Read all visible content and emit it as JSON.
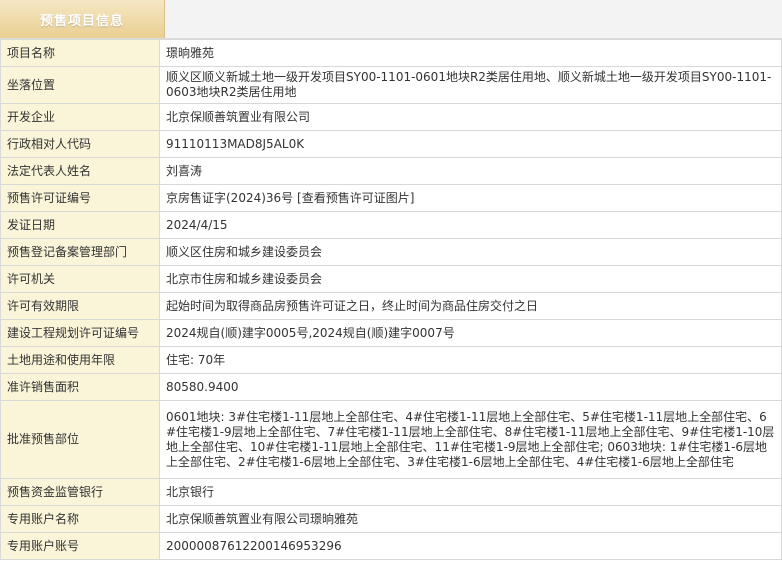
{
  "header": {
    "tab_title": "预售项目信息"
  },
  "fields": [
    {
      "label": "项目名称",
      "value": "璟晌雅苑"
    },
    {
      "label": "坐落位置",
      "value": "顺义区顺义新城土地一级开发项目SY00-1101-0601地块R2类居住用地、顺义新城土地一级开发项目SY00-1101-0603地块R2类居住用地"
    },
    {
      "label": "开发企业",
      "value": "北京保顺善筑置业有限公司"
    },
    {
      "label": "行政相对人代码",
      "value": "91110113MAD8J5AL0K"
    },
    {
      "label": "法定代表人姓名",
      "value": "刘喜涛"
    },
    {
      "label": "预售许可证编号",
      "value": "京房售证字(2024)36号",
      "link": "[查看预售许可证图片]"
    },
    {
      "label": "发证日期",
      "value": "2024/4/15"
    },
    {
      "label": "预售登记备案管理部门",
      "value": "顺义区住房和城乡建设委员会"
    },
    {
      "label": "许可机关",
      "value": "北京市住房和城乡建设委员会"
    },
    {
      "label": "许可有效期限",
      "value": "起始时间为取得商品房预售许可证之日，终止时间为商品住房交付之日"
    },
    {
      "label": "建设工程规划许可证编号",
      "value": "2024规自(顺)建字0005号,2024规自(顺)建字0007号"
    },
    {
      "label": "土地用途和使用年限",
      "value": "住宅: 70年"
    },
    {
      "label": "准许销售面积",
      "value": "80580.9400"
    },
    {
      "label": "批准预售部位",
      "value": "0601地块: 3#住宅楼1-11层地上全部住宅、4#住宅楼1-11层地上全部住宅、5#住宅楼1-11层地上全部住宅、6#住宅楼1-9层地上全部住宅、7#住宅楼1-11层地上全部住宅、8#住宅楼1-11层地上全部住宅、9#住宅楼1-10层地上全部住宅、10#住宅楼1-11层地上全部住宅、11#住宅楼1-9层地上全部住宅; 0603地块: 1#住宅楼1-6层地上全部住宅、2#住宅楼1-6层地上全部住宅、3#住宅楼1-6层地上全部住宅、4#住宅楼1-6层地上全部住宅"
    },
    {
      "label": "预售资金监管银行",
      "value": "北京银行"
    },
    {
      "label": "专用账户名称",
      "value": "北京保顺善筑置业有限公司璟晌雅苑"
    },
    {
      "label": "专用账户账号",
      "value": "20000087612200146953296"
    }
  ]
}
